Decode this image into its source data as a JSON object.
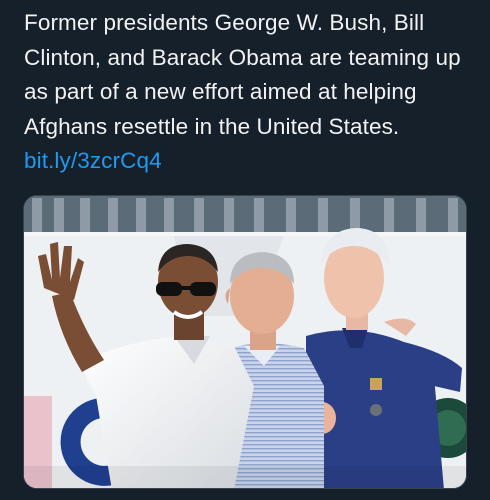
{
  "tweet": {
    "text": "Former presidents George W. Bush, Bill Clinton, and Barack Obama are teaming up as part of a new effort aimed at helping Afghans resettle in the United States.",
    "link": "bit.ly/3zcrCq4"
  },
  "media": {
    "kind": "photo"
  },
  "colors": {
    "background": "#15202b",
    "text": "#f2f2f2",
    "link": "#1d9bf0"
  }
}
